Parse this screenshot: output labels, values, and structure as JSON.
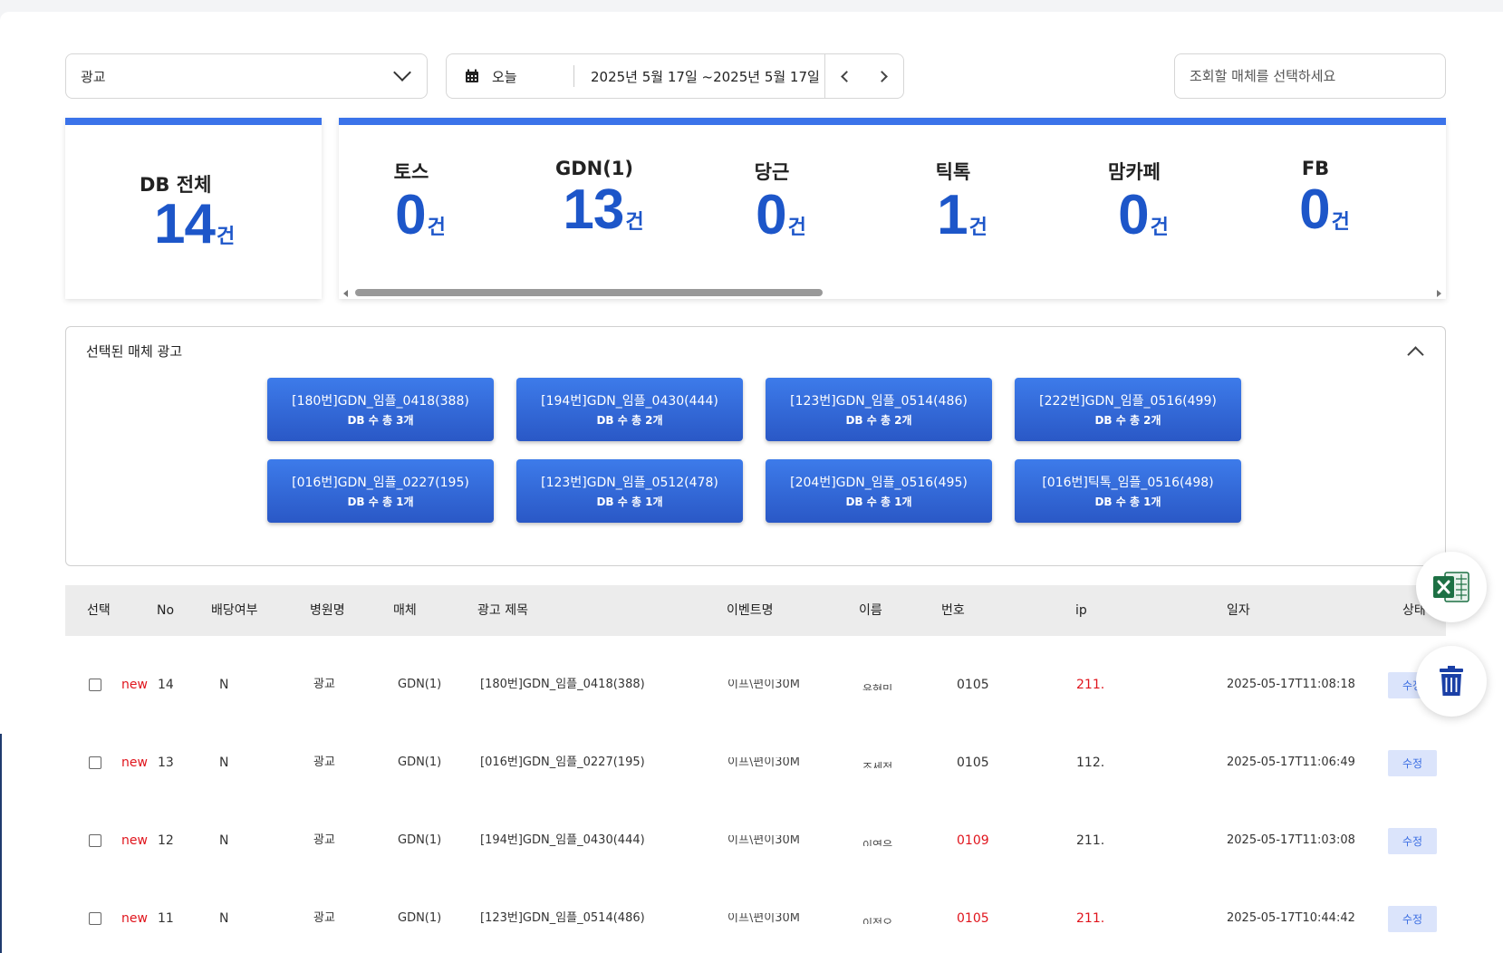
{
  "toolbar": {
    "category_select": "광교",
    "date_preset": "오늘",
    "date_range": "2025년 5월 17일 ~2025년 5월 17일",
    "media_placeholder": "조회할 매체를 선택하세요"
  },
  "stats": {
    "total": {
      "title": "DB 전체",
      "value": "14",
      "unit": "건"
    },
    "media": [
      {
        "name": "토스",
        "value": "0",
        "unit": "건"
      },
      {
        "name": "GDN(1)",
        "value": "13",
        "unit": "건"
      },
      {
        "name": "당근",
        "value": "0",
        "unit": "건"
      },
      {
        "name": "틱톡",
        "value": "1",
        "unit": "건"
      },
      {
        "name": "맘카페",
        "value": "0",
        "unit": "건"
      },
      {
        "name": "FB",
        "value": "0",
        "unit": "건"
      }
    ]
  },
  "ads_panel": {
    "title": "선택된 매체 광고",
    "ads": [
      {
        "title": "[180번]GDN_임플_0418(388)",
        "count": "DB 수 총 3개"
      },
      {
        "title": "[194번]GDN_임플_0430(444)",
        "count": "DB 수 총 2개"
      },
      {
        "title": "[123번]GDN_임플_0514(486)",
        "count": "DB 수 총 2개"
      },
      {
        "title": "[222번]GDN_임플_0516(499)",
        "count": "DB 수 총 2개"
      },
      {
        "title": "[016번]GDN_임플_0227(195)",
        "count": "DB 수 총 1개"
      },
      {
        "title": "[123번]GDN_임플_0512(478)",
        "count": "DB 수 총 1개"
      },
      {
        "title": "[204번]GDN_임플_0516(495)",
        "count": "DB 수 총 1개"
      },
      {
        "title": "[016번]틱톡_임플_0516(498)",
        "count": "DB 수 총 1개"
      }
    ]
  },
  "table": {
    "headers": [
      "선택",
      "No",
      "배당여부",
      "병원명",
      "매체",
      "광고 제목",
      "이벤트명",
      "이름",
      "번호",
      "ip",
      "일자",
      "상태"
    ],
    "rows": [
      {
        "badge": "new",
        "no": "14",
        "assigned": "N",
        "hospital": "광교",
        "media": "GDN(1)",
        "ad_title": "[180번]GDN_임플_0418(388)",
        "event": "이프\\편이30M",
        "name": "윤현민",
        "phone": "0105",
        "ip": "211.",
        "date": "2025-05-17T11:08:18",
        "status": "수정"
      },
      {
        "badge": "new",
        "no": "13",
        "assigned": "N",
        "hospital": "광교",
        "media": "GDN(1)",
        "ad_title": "[016번]GDN_임플_0227(195)",
        "event": "이프\\편이30M",
        "name": "조세정",
        "phone": "0105",
        "ip": "112.",
        "date": "2025-05-17T11:06:49",
        "status": "수정"
      },
      {
        "badge": "new",
        "no": "12",
        "assigned": "N",
        "hospital": "광교",
        "media": "GDN(1)",
        "ad_title": "[194번]GDN_임플_0430(444)",
        "event": "이프\\편이30M",
        "name": "이영은",
        "phone": "0109",
        "ip": "211.",
        "date": "2025-05-17T11:03:08",
        "status": "수정"
      },
      {
        "badge": "new",
        "no": "11",
        "assigned": "N",
        "hospital": "광교",
        "media": "GDN(1)",
        "ad_title": "[123번]GDN_임플_0514(486)",
        "event": "이프\\편이30M",
        "name": "이정오",
        "phone": "0105",
        "ip": "211.",
        "date": "2025-05-17T10:44:42",
        "status": "수정"
      }
    ]
  },
  "colors": {
    "accent": "#3b73ea",
    "count_blue": "#1d56c9",
    "alert_red": "#e0141c"
  },
  "icons": {
    "calendar": "calendar-icon",
    "excel": "excel-icon",
    "trash": "trash-icon"
  }
}
